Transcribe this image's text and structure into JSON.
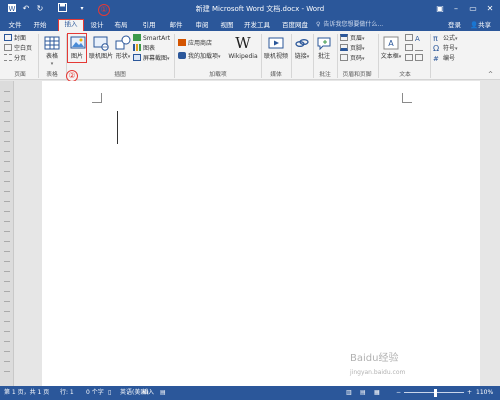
{
  "titlebar": {
    "title": "新建 Microsoft Word 文档.docx - Word",
    "save_icon": "save-icon",
    "undo_icon": "undo-icon",
    "redo_icon": "redo-icon",
    "qat_dropdown_icon": "chevron-down-icon",
    "ribbon_display_icon": "ribbon-display-icon",
    "minimize_icon": "minimize-icon",
    "maximize_icon": "maximize-icon",
    "close_icon": "close-icon"
  },
  "tabs": [
    {
      "label": "文件"
    },
    {
      "label": "开始"
    },
    {
      "label": "插入",
      "active": true
    },
    {
      "label": "设计"
    },
    {
      "label": "布局"
    },
    {
      "label": "引用"
    },
    {
      "label": "邮件"
    },
    {
      "label": "审阅"
    },
    {
      "label": "视图"
    },
    {
      "label": "开发工具"
    },
    {
      "label": "百度网盘"
    }
  ],
  "tell_me": {
    "placeholder": "告诉我您想要做什么..."
  },
  "account": {
    "login": "登录",
    "share": "共享"
  },
  "ribbon": {
    "pages": {
      "items": [
        "封面",
        "空白页",
        "分页"
      ],
      "label": "页面"
    },
    "tables": {
      "table": "表格",
      "label": "表格"
    },
    "illustrations": {
      "picture": "图片",
      "online_picture": "联机图片",
      "shapes": "形状",
      "smartart": "SmartArt",
      "chart": "图表",
      "screenshot": "屏幕截图",
      "label": "插图"
    },
    "addins": {
      "store": "应用商店",
      "my_addins": "我的加载项",
      "wikipedia": "Wikipedia",
      "label": "加载项"
    },
    "media": {
      "online_video": "联机视频",
      "label": "媒体"
    },
    "links": {
      "link": "链接"
    },
    "comments": {
      "comment": "批注",
      "label": "批注"
    },
    "header_footer": {
      "header": "页眉",
      "footer": "页脚",
      "page_number": "页码",
      "label": "页眉和页脚"
    },
    "text": {
      "textbox": "文本框",
      "label": "文本"
    },
    "symbols": {
      "equation": "公式",
      "symbol": "符号",
      "numbering": "编号"
    }
  },
  "callouts": {
    "one": "①",
    "two": "②"
  },
  "status": {
    "page": "第 1 页，共 1 页",
    "line": "行: 1",
    "words": "0 个字",
    "language": "英语(美国)",
    "mode": "插入",
    "zoom": "110%",
    "zoom_out": "−",
    "zoom_in": "+"
  },
  "watermark": {
    "text": "Baidu经验",
    "sub": "jingyan.baidu.com"
  },
  "colors": {
    "accent": "#2b579a",
    "highlight": "#e53935"
  }
}
